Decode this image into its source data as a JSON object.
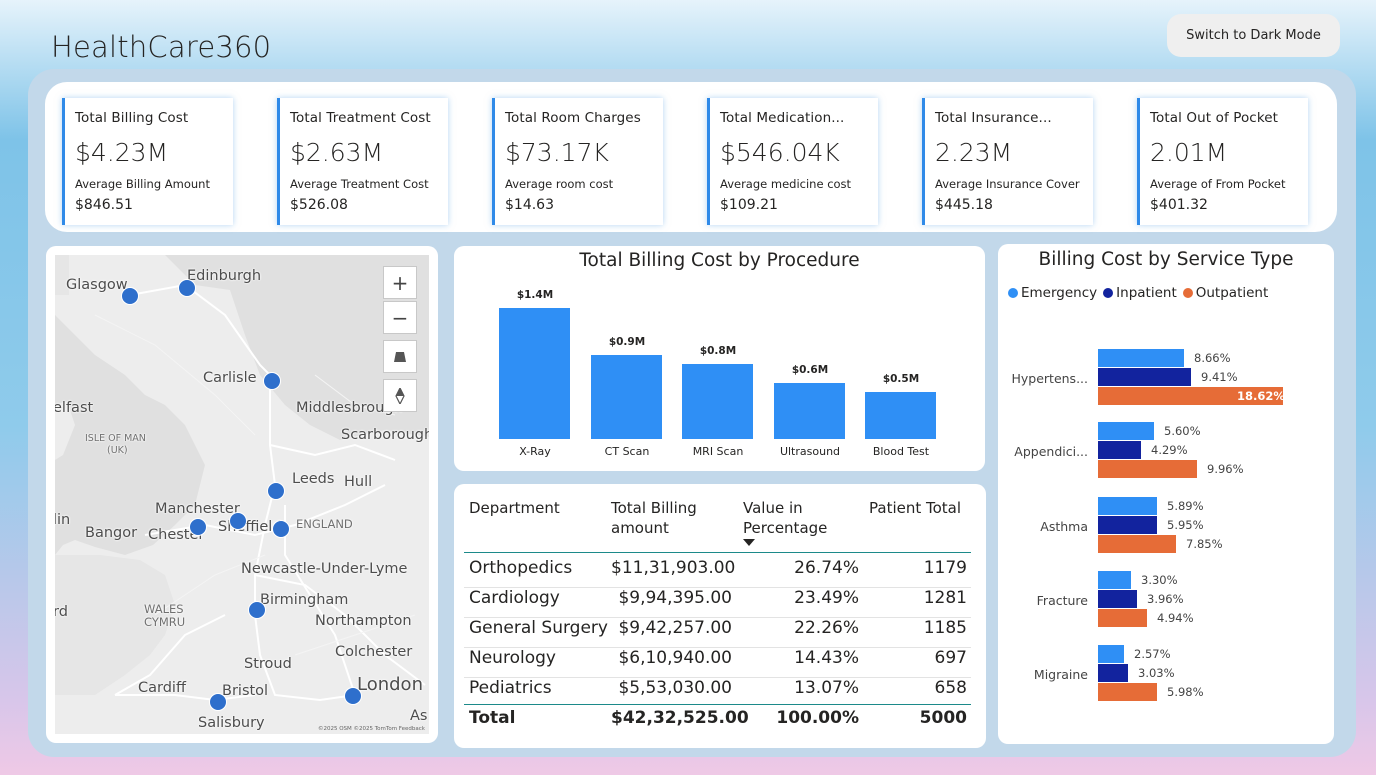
{
  "app": {
    "title": "HealthCare360",
    "dark_mode_button": "Switch to Dark Mode"
  },
  "kpis": [
    {
      "label": "Total Billing Cost",
      "value": "$4.23M",
      "sub_label": "Average Billing Amount",
      "sub_value": "$846.51"
    },
    {
      "label": "Total Treatment Cost",
      "value": "$2.63M",
      "sub_label": "Average Treatment Cost",
      "sub_value": "$526.08"
    },
    {
      "label": "Total Room Charges",
      "value": "$73.17K",
      "sub_label": "Average room cost",
      "sub_value": "$14.63"
    },
    {
      "label": "Total Medication...",
      "value": "$546.04K",
      "sub_label": "Average medicine cost",
      "sub_value": "$109.21"
    },
    {
      "label": "Total Insurance...",
      "value": "2.23M",
      "sub_label": "Average Insurance Cover",
      "sub_value": "$445.18"
    },
    {
      "label": "Total Out of Pocket",
      "value": "2.01M",
      "sub_label": "Average of From Pocket",
      "sub_value": "$401.32"
    }
  ],
  "map": {
    "controls": {
      "zoom_in": "+",
      "zoom_out": "−"
    },
    "place_labels": [
      "Glasgow",
      "Edinburgh",
      "Carlisle",
      "Middlesbrough",
      "Scarborough",
      "elfast",
      "ISLE OF MAN",
      "(UK)",
      "Leeds",
      "Hull",
      "Manchester",
      "lin",
      "Bangor",
      "Chester",
      "Sheffield",
      "ENGLAND",
      "Newcastle-Under-Lyme",
      "Birmingham",
      "WALES",
      "CYMRU",
      "rd",
      "Northampton",
      "Colchester",
      "Stroud",
      "Cardiff",
      "Bristol",
      "London",
      "Salisbury",
      "As"
    ],
    "attribution": "©2025 OSM ©2025 TomTom Feedback"
  },
  "procedure_chart": {
    "title": "Total Billing Cost by Procedure",
    "value_labels": [
      "$1.4M",
      "$0.9M",
      "$0.8M",
      "$0.6M",
      "$0.5M"
    ]
  },
  "chart_data": [
    {
      "type": "bar",
      "title": "Total Billing Cost by Procedure",
      "categories": [
        "X-Ray",
        "CT Scan",
        "MRI Scan",
        "Ultrasound",
        "Blood Test"
      ],
      "values": [
        1.4,
        0.9,
        0.8,
        0.6,
        0.5
      ],
      "unit": "$M",
      "color": "#2f8ff5"
    },
    {
      "type": "bar",
      "orientation": "horizontal",
      "title": "Billing Cost by Service Type",
      "categories": [
        "Hypertens...",
        "Appendici...",
        "Asthma",
        "Fracture",
        "Migraine"
      ],
      "series": [
        {
          "name": "Emergency",
          "color": "#2f8ff5",
          "values": [
            8.66,
            5.6,
            5.89,
            3.3,
            2.57
          ]
        },
        {
          "name": "Inpatient",
          "color": "#12239e",
          "values": [
            9.41,
            4.29,
            5.95,
            3.96,
            3.03
          ]
        },
        {
          "name": "Outpatient",
          "color": "#e66c37",
          "values": [
            18.62,
            9.96,
            7.85,
            4.94,
            5.98
          ]
        }
      ],
      "unit": "%",
      "legend": "top-left"
    }
  ],
  "service_chart": {
    "title": "Billing Cost by Service Type",
    "value_labels": [
      [
        "8.66%",
        "9.41%",
        "18.62%"
      ],
      [
        "5.60%",
        "4.29%",
        "9.96%"
      ],
      [
        "5.89%",
        "5.95%",
        "7.85%"
      ],
      [
        "3.30%",
        "3.96%",
        "4.94%"
      ],
      [
        "2.57%",
        "3.03%",
        "5.98%"
      ]
    ]
  },
  "department_table": {
    "headers": [
      "Department",
      "Total Billing amount",
      "Value in Percentage",
      "Patient Total"
    ],
    "rows": [
      [
        "Orthopedics",
        "$11,31,903.00",
        "26.74%",
        "1179"
      ],
      [
        "Cardiology",
        "$9,94,395.00",
        "23.49%",
        "1281"
      ],
      [
        "General Surgery",
        "$9,42,257.00",
        "22.26%",
        "1185"
      ],
      [
        "Neurology",
        "$6,10,940.00",
        "14.43%",
        "697"
      ],
      [
        "Pediatrics",
        "$5,53,030.00",
        "13.07%",
        "658"
      ]
    ],
    "total": [
      "Total",
      "$42,32,525.00",
      "100.00%",
      "5000"
    ],
    "sort_column": "Value in Percentage",
    "sort_direction": "descending"
  }
}
